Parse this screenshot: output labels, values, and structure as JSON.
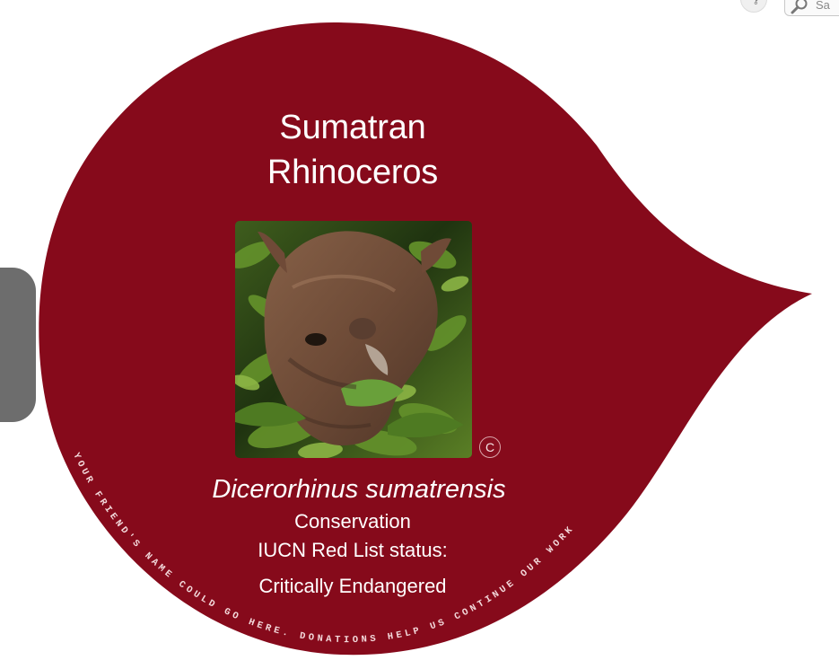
{
  "header": {
    "search_placeholder": "Sa",
    "search_icon": "search-icon",
    "mini_icon": "key-icon",
    "mini_glyph": "⚷"
  },
  "card": {
    "title_line1": "Sumatran",
    "title_line2": "Rhinoceros",
    "scientific_name": "Dicerorhinus sumatrensis",
    "conservation_label": "Conservation",
    "iucn_label": "IUCN Red List status:",
    "status": "Critically Endangered",
    "copyright_glyph": "C",
    "curved_message": "YOUR FRIEND'S NAME COULD GO HERE. DONATIONS HELP US CONTINUE OUR WORK",
    "colors": {
      "card_red": "#860a1b",
      "text_white": "#ffffff"
    }
  }
}
